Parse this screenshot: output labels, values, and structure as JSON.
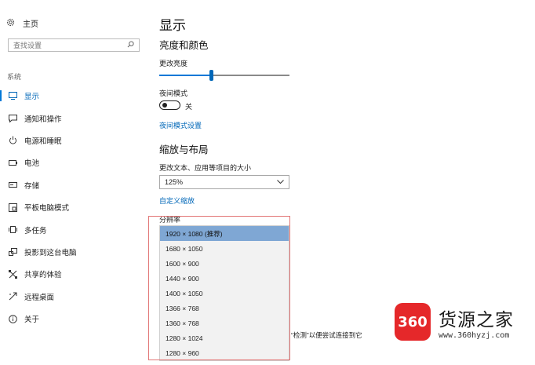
{
  "sidebar": {
    "home_label": "主页",
    "search_placeholder": "查找设置",
    "section_label": "系统",
    "items": [
      {
        "label": "显示",
        "icon": "monitor-icon"
      },
      {
        "label": "通知和操作",
        "icon": "notification-icon"
      },
      {
        "label": "电源和睡眠",
        "icon": "power-icon"
      },
      {
        "label": "电池",
        "icon": "battery-icon"
      },
      {
        "label": "存储",
        "icon": "storage-icon"
      },
      {
        "label": "平板电脑模式",
        "icon": "tablet-icon"
      },
      {
        "label": "多任务",
        "icon": "multitask-icon"
      },
      {
        "label": "投影到这台电脑",
        "icon": "project-icon"
      },
      {
        "label": "共享的体验",
        "icon": "shared-icon"
      },
      {
        "label": "远程桌面",
        "icon": "remote-icon"
      },
      {
        "label": "关于",
        "icon": "info-icon"
      }
    ]
  },
  "main": {
    "title": "显示",
    "brightness_heading": "亮度和颜色",
    "brightness_label": "更改亮度",
    "brightness_level": 0.4,
    "night_mode_label": "夜间模式",
    "night_mode_state": "关",
    "night_mode_link": "夜间模式设置",
    "scale_heading": "缩放与布局",
    "scale_label": "更改文本、应用等项目的大小",
    "scale_value": "125%",
    "custom_scale_link": "自定义缩放",
    "resolution_label": "分辨率",
    "resolution_options": [
      "1920 × 1080 (推荐)",
      "1680 × 1050",
      "1600 × 900",
      "1440 × 900",
      "1400 × 1050",
      "1366 × 768",
      "1360 × 768",
      "1280 × 1024",
      "1280 × 960"
    ],
    "selected_index": 0,
    "obscured_text": "“检测”以便尝试连接到它"
  },
  "watermark": {
    "badge": "360",
    "name": "货源之家",
    "url": "www.360hyzj.com"
  },
  "colors": {
    "accent": "#0078d7",
    "selected": "#7fa7d4",
    "highlight_box": "#e27575",
    "watermark_red": "#e5282a"
  }
}
